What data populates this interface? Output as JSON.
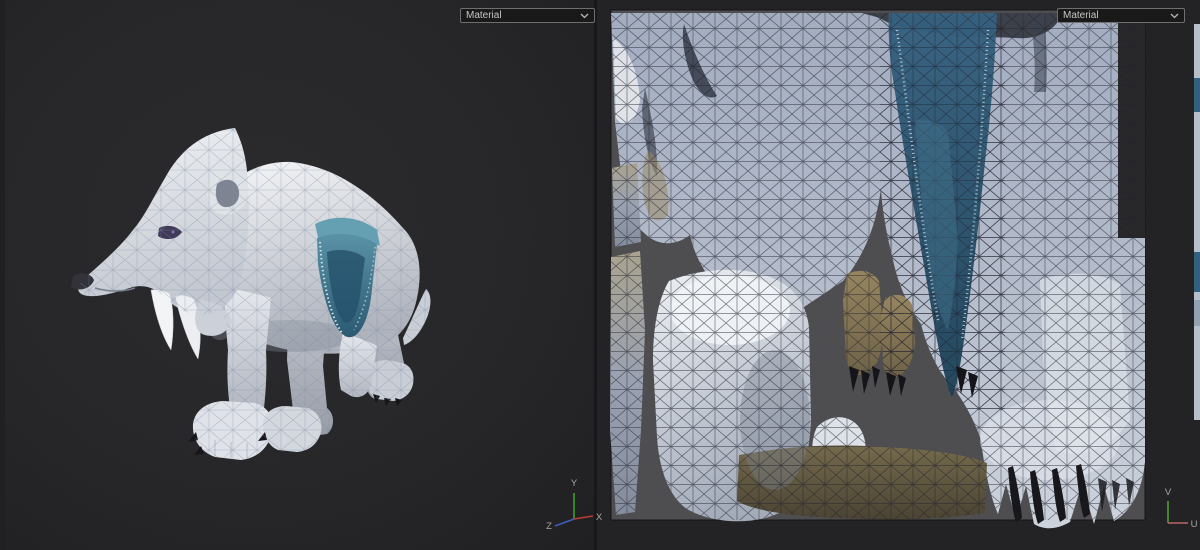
{
  "left_viewport": {
    "material_selector": {
      "value": "Material",
      "icon": "chevron-down-icon"
    },
    "axis_gizmo": {
      "x_label": "X",
      "y_label": "Y",
      "z_label": "Z"
    }
  },
  "right_viewport": {
    "material_selector": {
      "value": "Material",
      "icon": "chevron-down-icon"
    },
    "axis_gizmo": {
      "u_label": "U",
      "v_label": "V"
    }
  },
  "colors": {
    "viewport_background": "#272729",
    "editor_background": "#232325",
    "texture_dead_space": "#4e4e51",
    "model_base": "#e9ecf0",
    "saddle_teal": "#3c7590",
    "axis_x_red": "#b53f35",
    "axis_y_green": "#3f9e26",
    "axis_z_blue": "#3a5fc0",
    "axis_u_red": "#b9666a",
    "axis_v_green": "#4f9e3a"
  }
}
